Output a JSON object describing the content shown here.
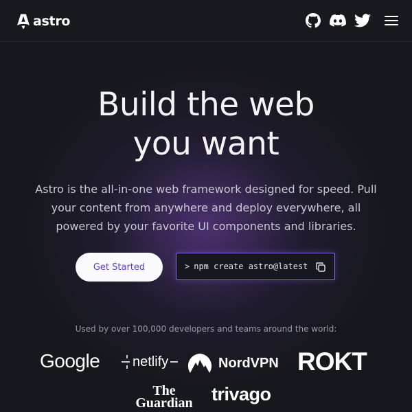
{
  "header": {
    "logo_text": "astro",
    "icons": [
      "github-icon",
      "discord-icon",
      "twitter-icon",
      "menu-icon"
    ]
  },
  "hero": {
    "title_line1": "Build the web",
    "title_line2": "you want",
    "subtitle": "Astro is the all-in-one web framework designed for speed. Pull your content from anywhere and deploy everywhere, all powered by your favorite UI components and libraries."
  },
  "cta": {
    "get_started_label": "Get Started",
    "command_prompt": ">",
    "command_text": "npm create astro@latest"
  },
  "logos": {
    "used_by_text": "Used by over 100,000 developers and teams around the world:",
    "google": "Google",
    "netlify": "netlify",
    "nordvpn": "NordVPN",
    "rokt": "ROKT",
    "guardian_line1": "The",
    "guardian_line2": "Guardian",
    "trivago": "trivago"
  },
  "colors": {
    "background": "#17181d",
    "accent": "#8b63e6",
    "button_text": "#5b3fd0"
  }
}
